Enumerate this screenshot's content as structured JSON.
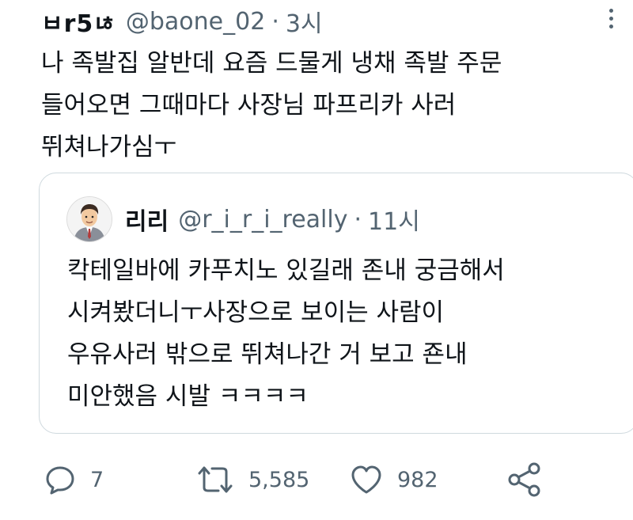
{
  "tweet": {
    "display_name": "ㅂr5ㄶ",
    "handle": "@baone_02",
    "separator": "·",
    "time": "3시",
    "text_lines": [
      "나 족발집 알반데 요즘 드물게 냉채 족발 주문",
      "들어오면 그때마다 사장님 파프리카 사러",
      "뛰쳐나가심ㅜ"
    ]
  },
  "quote": {
    "display_name": "리리",
    "handle": "@r_i_r_i_really",
    "separator": "·",
    "time": "11시",
    "text_lines": [
      "칵테일바에 카푸치노 있길래 존내 궁금해서",
      "시켜봤더니ㅜ사장으로 보이는 사람이",
      "우유사러 밖으로 뛰쳐나간 거 보고 죤내",
      "미안했음 시발 ㅋㅋㅋㅋ"
    ]
  },
  "actions": {
    "reply_count": "7",
    "retweet_count": "5,585",
    "like_count": "982"
  },
  "icons": {
    "more": "more-horizontal-icon",
    "reply": "reply-icon",
    "retweet": "retweet-icon",
    "like": "heart-icon",
    "share": "share-icon"
  },
  "colors": {
    "text": "#0f1419",
    "secondary": "#536471",
    "border": "#cfd9de"
  }
}
